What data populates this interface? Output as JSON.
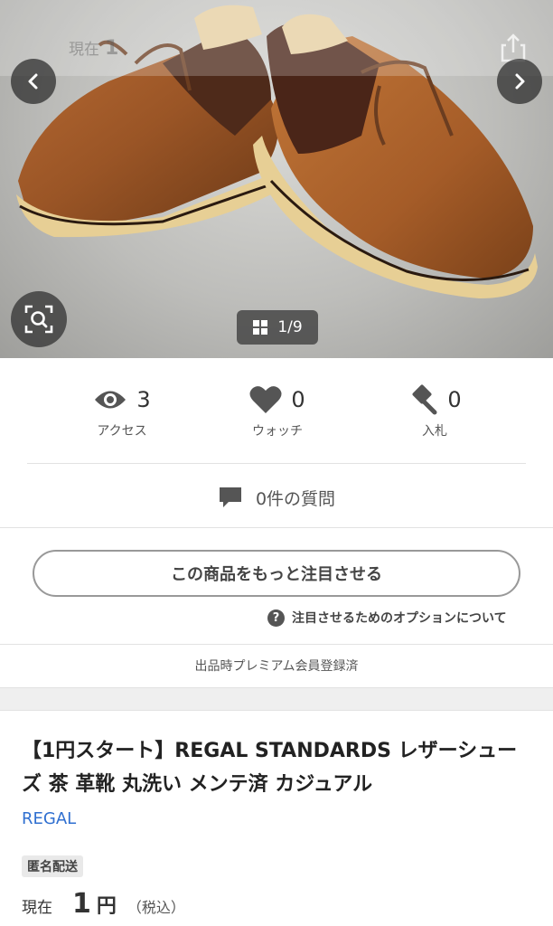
{
  "hero": {
    "ghost_label": "現在",
    "ghost_value": "1",
    "image_counter": "1/9"
  },
  "stats": {
    "access": {
      "count": "3",
      "label": "アクセス",
      "icon": "eye-icon"
    },
    "watch": {
      "count": "0",
      "label": "ウォッチ",
      "icon": "heart-icon"
    },
    "bid": {
      "count": "0",
      "label": "入札",
      "icon": "gavel-icon"
    }
  },
  "questions": {
    "label": "0件の質問",
    "icon": "speech-bubble-icon"
  },
  "promote": {
    "button_label": "この商品をもっと注目させる",
    "options_link": "注目させるためのオプションについて"
  },
  "premium_note": "出品時プレミアム会員登録済",
  "item": {
    "title": "【1円スタート】REGAL STANDARDS レザーシューズ 茶 革靴 丸洗い メンテ済 カジュアル",
    "brand": "REGAL",
    "shipping_tag": "匿名配送",
    "price_label": "現在",
    "price_value": "1",
    "price_unit": "円",
    "price_tax": "（税込）"
  },
  "colors": {
    "brand_link": "#2f6fd0",
    "text_dark": "#222222",
    "icon_gray": "#555555"
  }
}
